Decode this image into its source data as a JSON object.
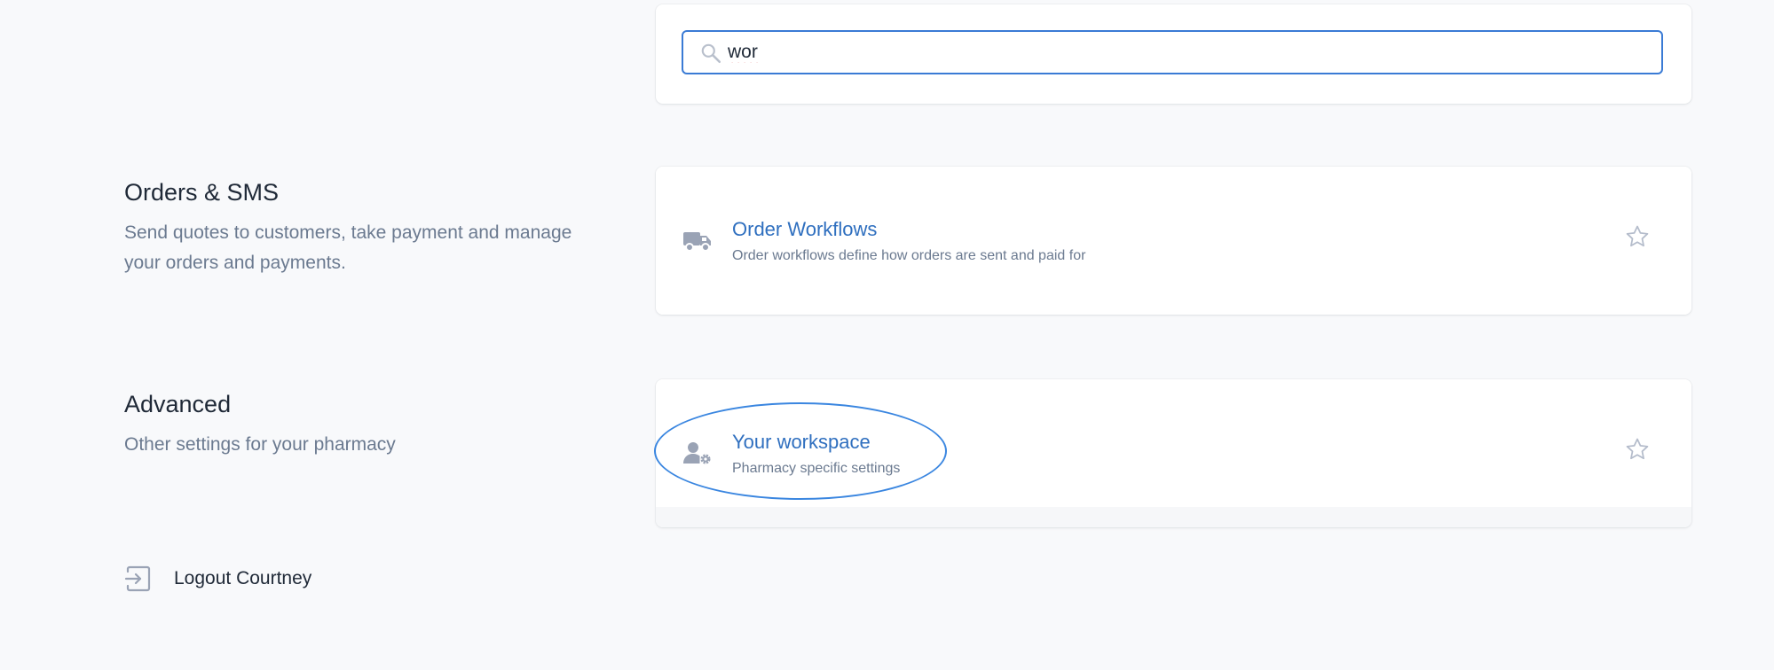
{
  "search": {
    "value": "wor",
    "icon": "search-icon"
  },
  "sections": [
    {
      "heading": "Orders & SMS",
      "description_lines": [
        "Send quotes to customers, take payment and manage",
        "your orders and payments."
      ],
      "items": [
        {
          "icon": "truck-icon",
          "title": "Order Workflows",
          "subtitle": "Order workflows define how orders are sent and paid for",
          "favorite_icon": "star-outline-icon"
        }
      ]
    },
    {
      "heading": "Advanced",
      "description_lines": [
        "Other settings for your pharmacy"
      ],
      "items": [
        {
          "icon": "user-settings-icon",
          "title": "Your workspace",
          "subtitle": "Pharmacy specific settings",
          "favorite_icon": "star-outline-icon"
        }
      ]
    }
  ],
  "logout": {
    "icon": "logout-icon",
    "label": "Logout Courtney"
  },
  "colors": {
    "background": "#f8f9fb",
    "card": "#ffffff",
    "accent": "#3a7bd5",
    "link": "#2f6fbf",
    "muted_text": "#6b7a90",
    "icon": "#9aa3b5",
    "highlight": "#3a86e0"
  }
}
